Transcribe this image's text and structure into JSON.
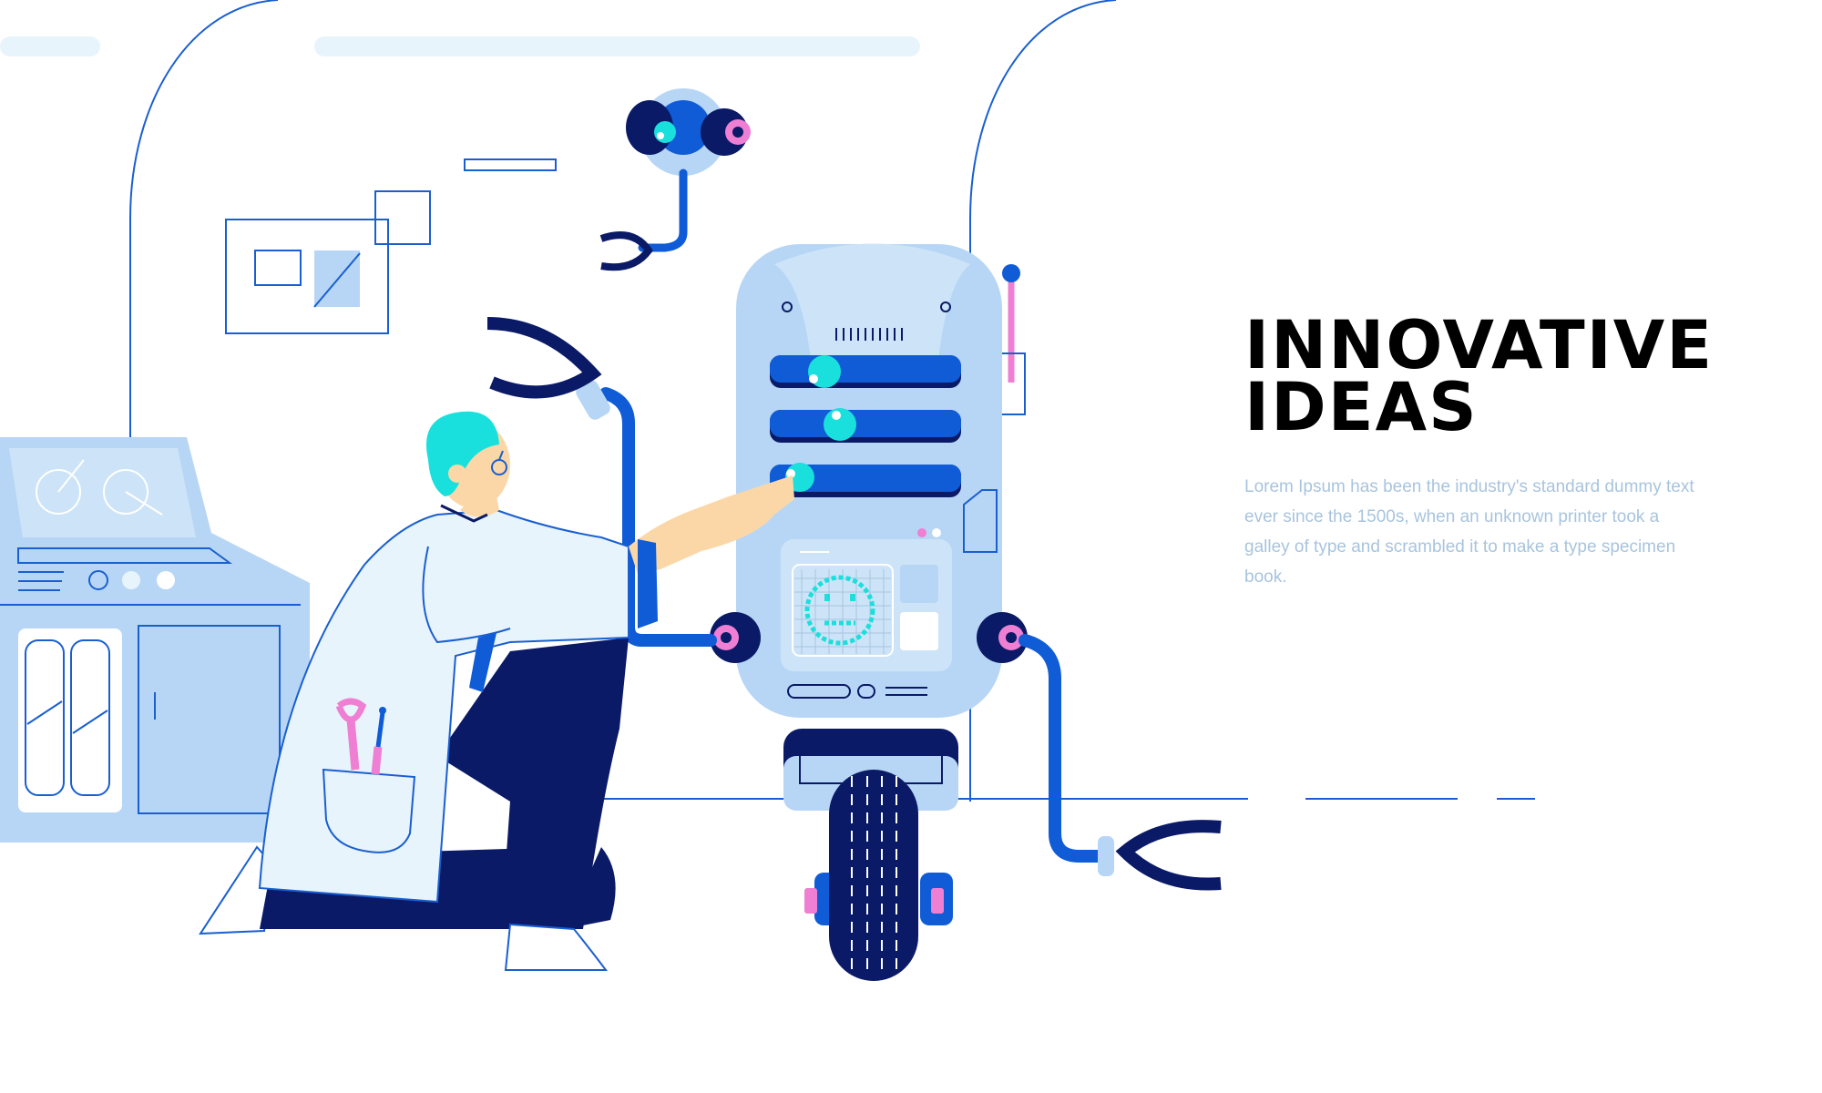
{
  "hero": {
    "headline_line1": "INNOVATIVE",
    "headline_line2": "IDEAS",
    "body": "Lorem Ipsum has been the industry's standard dummy text ever since the 1500s, when an unknown printer took a galley of type and scrambled it to make a type specimen book."
  },
  "illustration": {
    "subject": "scientist repairing robot",
    "colors": {
      "primary_blue": "#0f5cd6",
      "navy": "#0a1a66",
      "light_blue": "#b7d6f5",
      "pale_blue": "#e8f4fc",
      "cyan": "#19e0dc",
      "pink": "#ef7fd3",
      "skin": "#fbd7a8",
      "text_muted": "#a8c4de"
    }
  }
}
